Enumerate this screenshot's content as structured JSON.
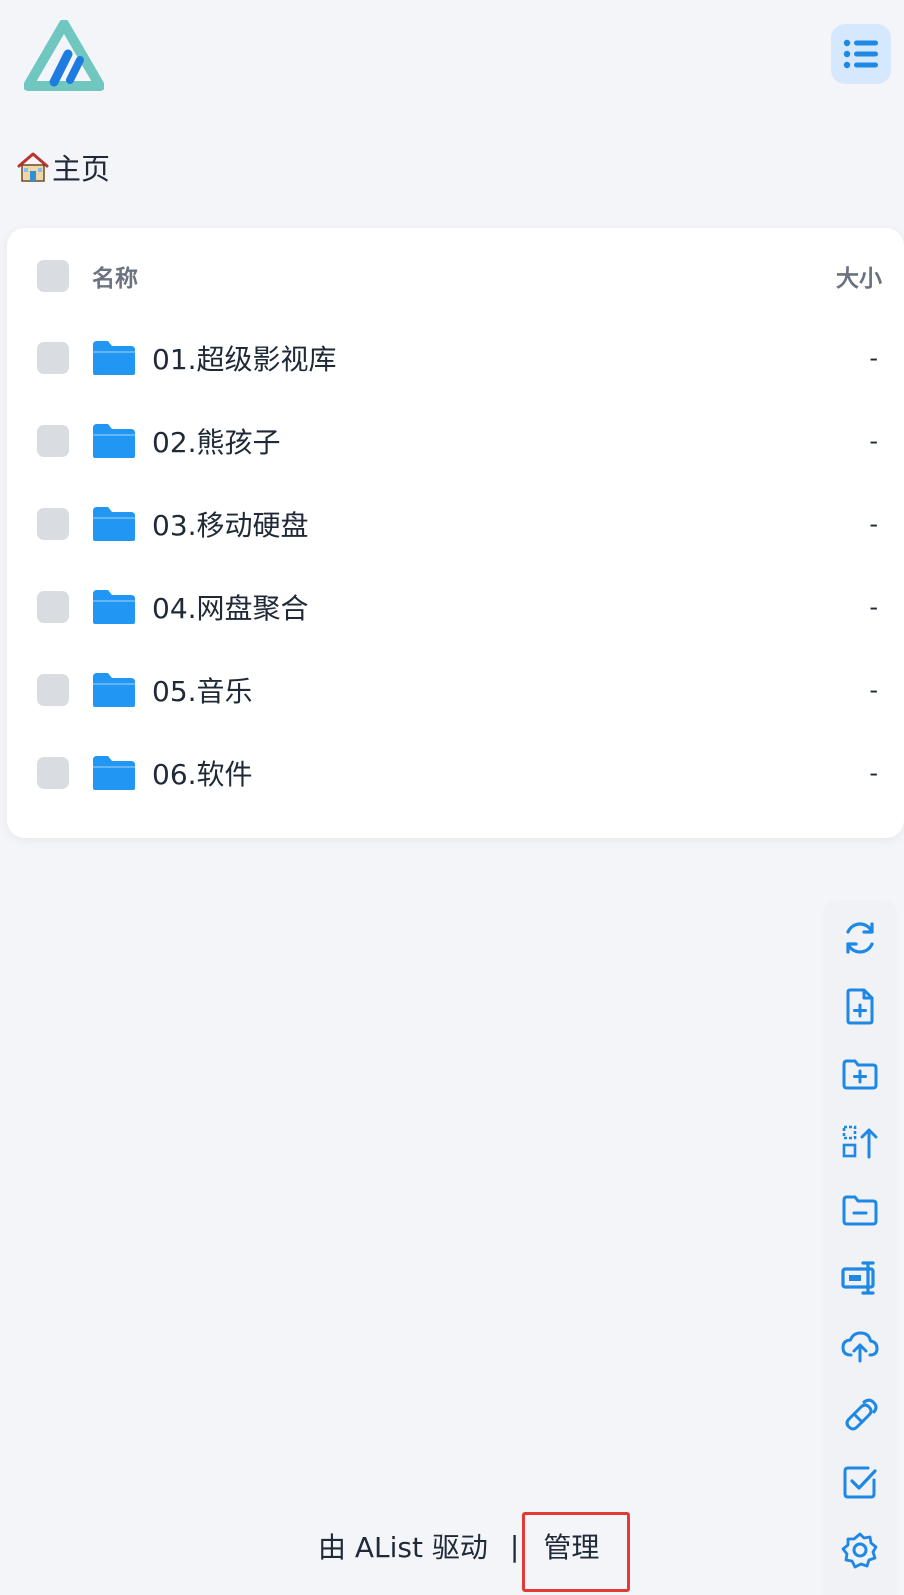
{
  "header": {
    "logo_icon": "alist-logo-icon",
    "menu_icon": "list-menu-icon"
  },
  "breadcrumb": {
    "icon": "house-icon",
    "label": "主页"
  },
  "file_list": {
    "columns": {
      "name": "名称",
      "size": "大小"
    },
    "items": [
      {
        "name": "01.超级影视库",
        "size": "-",
        "icon": "folder-icon"
      },
      {
        "name": "02.熊孩子",
        "size": "-",
        "icon": "folder-icon"
      },
      {
        "name": "03.移动硬盘",
        "size": "-",
        "icon": "folder-icon"
      },
      {
        "name": "04.网盘聚合",
        "size": "-",
        "icon": "folder-icon"
      },
      {
        "name": "05.音乐",
        "size": "-",
        "icon": "folder-icon"
      },
      {
        "name": "06.软件",
        "size": "-",
        "icon": "folder-icon"
      }
    ]
  },
  "toolbar": {
    "tools": [
      "refresh-icon",
      "new-file-icon",
      "new-folder-icon",
      "batch-upload-icon",
      "remove-folder-icon",
      "rename-icon",
      "upload-cloud-icon",
      "offline-download-icon",
      "select-check-icon",
      "settings-icon"
    ]
  },
  "footer": {
    "powered_by": "由 AList 驱动",
    "separator": "|",
    "manage_label": "管理"
  },
  "colors": {
    "accent": "#1e88e5",
    "folder": "#2196f3",
    "logo_teal": "#6fc7c0",
    "logo_blue": "#1e7be0",
    "highlight": "#e53935",
    "background": "#f4f5f9"
  }
}
